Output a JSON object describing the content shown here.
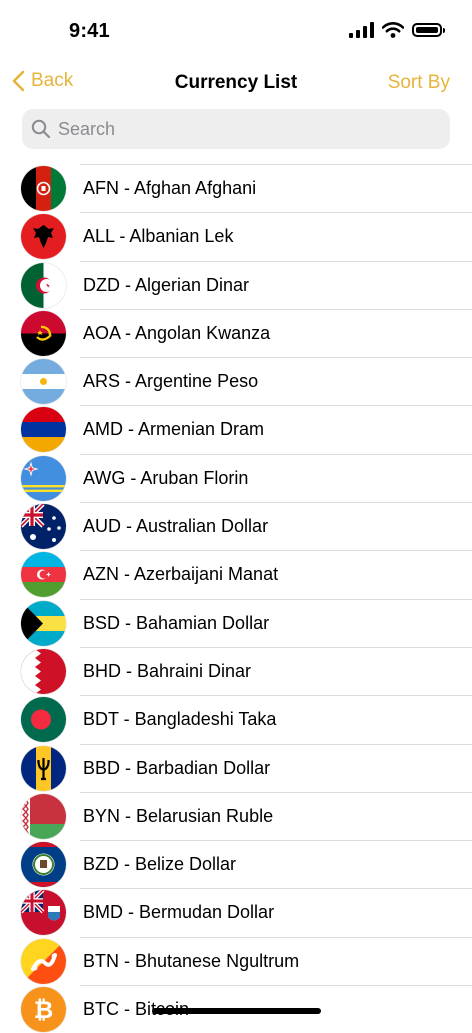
{
  "status_bar": {
    "time": "9:41"
  },
  "nav": {
    "back_label": "Back",
    "title": "Currency List",
    "sort_label": "Sort By"
  },
  "search": {
    "placeholder": "Search"
  },
  "colors": {
    "accent": "#e6b43a",
    "separator": "#dcdcdf",
    "search_bg": "#eeeeef"
  },
  "currencies": [
    {
      "label": "AFN - Afghan Afghani",
      "flag_icon": "afghanistan-flag-icon"
    },
    {
      "label": "ALL - Albanian Lek",
      "flag_icon": "albania-flag-icon"
    },
    {
      "label": "DZD - Algerian Dinar",
      "flag_icon": "algeria-flag-icon"
    },
    {
      "label": "AOA - Angolan Kwanza",
      "flag_icon": "angola-flag-icon"
    },
    {
      "label": "ARS - Argentine Peso",
      "flag_icon": "argentina-flag-icon"
    },
    {
      "label": "AMD - Armenian Dram",
      "flag_icon": "armenia-flag-icon"
    },
    {
      "label": "AWG - Aruban Florin",
      "flag_icon": "aruba-flag-icon"
    },
    {
      "label": "AUD - Australian Dollar",
      "flag_icon": "australia-flag-icon"
    },
    {
      "label": "AZN - Azerbaijani Manat",
      "flag_icon": "azerbaijan-flag-icon"
    },
    {
      "label": "BSD - Bahamian Dollar",
      "flag_icon": "bahamas-flag-icon"
    },
    {
      "label": "BHD - Bahraini Dinar",
      "flag_icon": "bahrain-flag-icon"
    },
    {
      "label": "BDT - Bangladeshi Taka",
      "flag_icon": "bangladesh-flag-icon"
    },
    {
      "label": "BBD - Barbadian Dollar",
      "flag_icon": "barbados-flag-icon"
    },
    {
      "label": "BYN - Belarusian Ruble",
      "flag_icon": "belarus-flag-icon"
    },
    {
      "label": "BZD - Belize Dollar",
      "flag_icon": "belize-flag-icon"
    },
    {
      "label": "BMD - Bermudan Dollar",
      "flag_icon": "bermuda-flag-icon"
    },
    {
      "label": "BTN - Bhutanese Ngultrum",
      "flag_icon": "bhutan-flag-icon"
    },
    {
      "label": "BTC - Bitcoin",
      "flag_icon": "bitcoin-icon"
    }
  ]
}
